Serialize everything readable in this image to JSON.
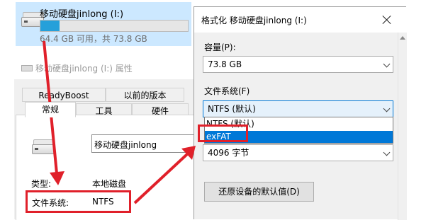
{
  "drive_tile": {
    "name": "移动硬盘jinlong (I:)",
    "free_text": "64.4 GB 可用，共 73.8 GB",
    "used_fraction": 0.13
  },
  "properties": {
    "title": "移动硬盘jinlong (I:) 属性",
    "tabs_row1": [
      "ReadyBoost",
      "以前的版本"
    ],
    "tabs_row2": [
      "常规",
      "工具",
      "硬件"
    ],
    "name_value": "移动硬盘jinlong",
    "type_label": "类型:",
    "type_value": "本地磁盘",
    "fs_label": "文件系统:",
    "fs_value": "NTFS"
  },
  "format_dialog": {
    "title": "格式化 移动硬盘jinlong (I:)",
    "capacity_label": "容量(P):",
    "capacity_value": "73.8 GB",
    "fs_label": "文件系统(F)",
    "fs_value": "NTFS (默认)",
    "fs_options": [
      "NTFS (默认)",
      "exFAT"
    ],
    "fs_highlighted": "exFAT",
    "alloc_value": "4096 字节",
    "restore_button": "还原设备的默认值(D)"
  },
  "colors": {
    "annotation": "#e0202a",
    "highlight": "#0078d7",
    "tile_selection": "#cce8ff",
    "progress": "#26a0da"
  }
}
